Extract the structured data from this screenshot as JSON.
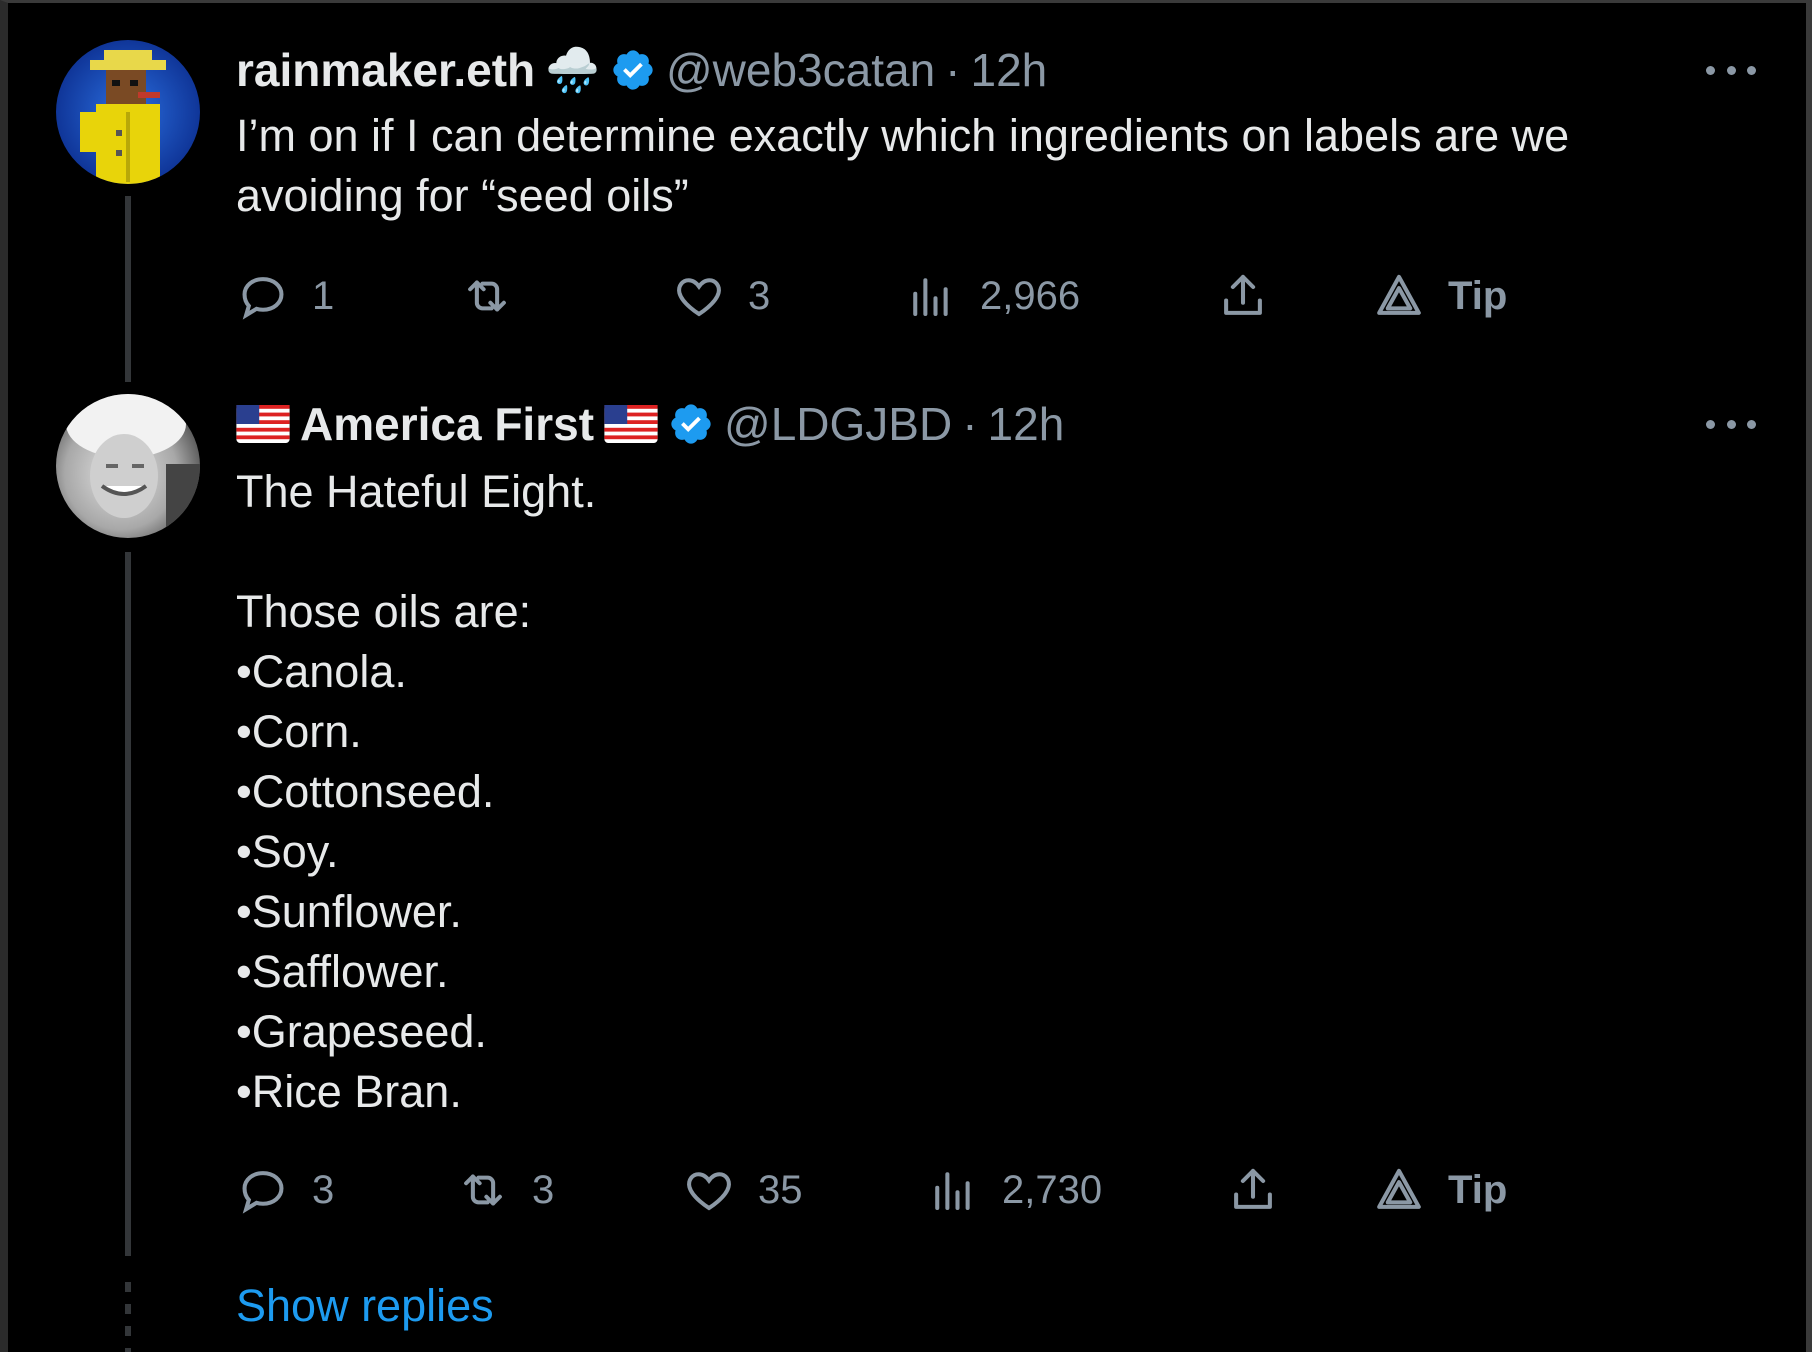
{
  "tweets": [
    {
      "name": "rainmaker.eth",
      "name_emoji": "🌧️",
      "handle": "@web3catan",
      "separator": "·",
      "time": "12h",
      "text_lines": [
        "I’m on if I can determine exactly which ingredients on labels are we",
        "avoiding for “seed oils”"
      ],
      "replies": "1",
      "retweets": "",
      "likes": "3",
      "views": "2,966",
      "tip_label": "Tip"
    },
    {
      "name": "America First",
      "handle": "@LDGJBD",
      "separator": "·",
      "time": "12h",
      "text_lines": [
        "The Hateful Eight.",
        "",
        "Those oils are:",
        "•Canola.",
        "•Corn.",
        "•Cottonseed.",
        "•Soy.",
        "•Sunflower.",
        "•Safflower.",
        "•Grapeseed.",
        "•Rice Bran."
      ],
      "replies": "3",
      "retweets": "3",
      "likes": "35",
      "views": "2,730",
      "tip_label": "Tip"
    }
  ],
  "show_replies": "Show replies",
  "colors": {
    "background": "#000000",
    "text": "#e7e9ea",
    "muted": "#8b98a5",
    "accent": "#1d9bf0",
    "verified": "#1d9bf0"
  },
  "icons": [
    "reply-icon",
    "retweet-icon",
    "like-icon",
    "views-icon",
    "share-icon",
    "tip-icon",
    "verified-badge-icon",
    "more-icon",
    "us-flag-icon"
  ]
}
